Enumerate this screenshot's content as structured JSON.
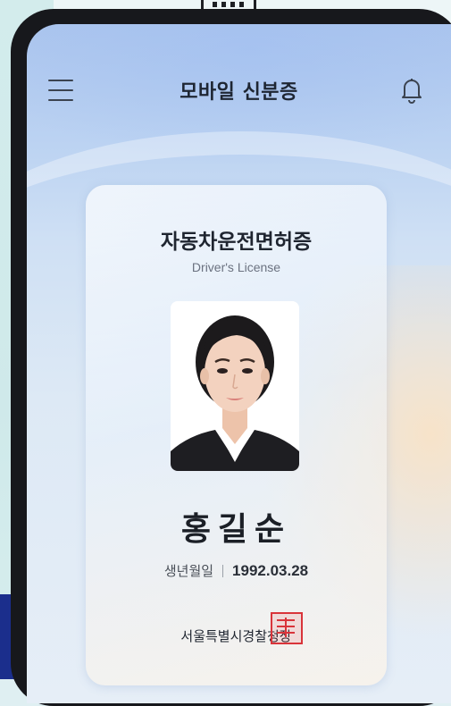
{
  "app": {
    "title": "모바일 신분증"
  },
  "icons": {
    "menu": "hamburger-menu-icon",
    "notifications": "bell-icon"
  },
  "card": {
    "title": "자동차운전면허증",
    "subtitle": "Driver's License",
    "name": "홍길순",
    "dob_label": "생년월일",
    "dob_value": "1992.03.28",
    "issuer": "서울특별시경찰청장"
  },
  "colors": {
    "seal": "#d9343a",
    "navy": "#1b2e8c",
    "frame": "#17181c"
  }
}
